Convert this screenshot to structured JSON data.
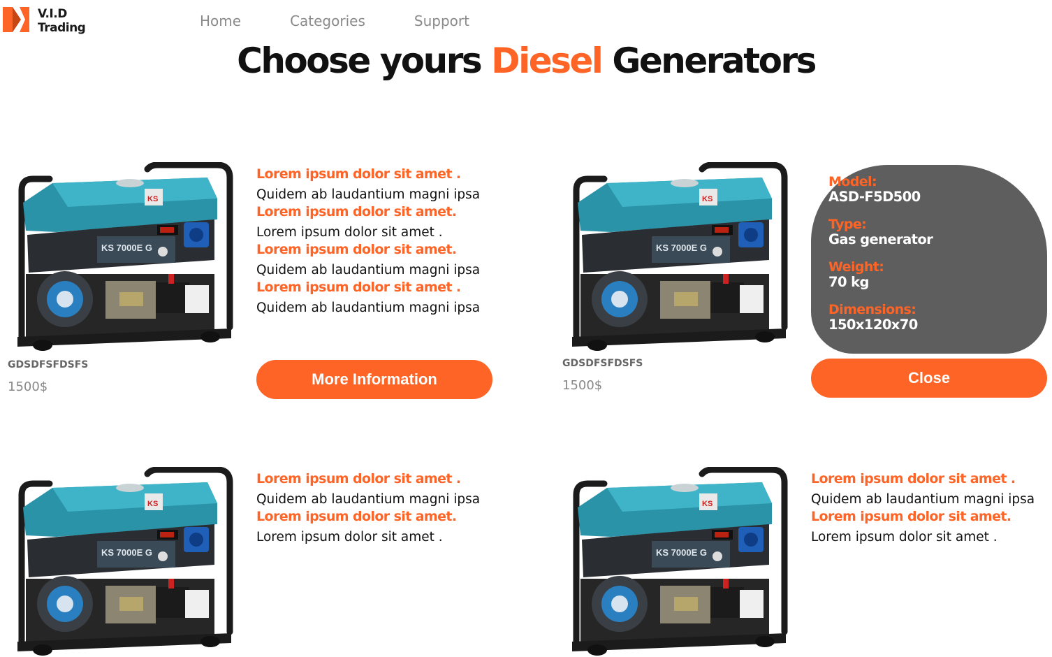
{
  "brand": {
    "line1": "V.I.D",
    "line2": "Trading",
    "color": "#fe6426"
  },
  "nav": [
    {
      "label": "Home"
    },
    {
      "label": "Categories"
    },
    {
      "label": "Support"
    }
  ],
  "headline": {
    "before": "Choose yours ",
    "accent": "Diesel",
    "after": " Generators"
  },
  "products": [
    {
      "sku": "GDSDFSFDSFS",
      "price": "1500$",
      "image_label": "KS 7000E G",
      "details": [
        {
          "label": "Lorem ipsum dolor sit amet .",
          "text": "Quidem ab laudantium magni ipsa"
        },
        {
          "label": "Lorem ipsum dolor sit amet.",
          "text": "Lorem ipsum dolor sit amet ."
        },
        {
          "label": "Lorem ipsum dolor sit amet.",
          "text": "Quidem ab laudantium magni ipsa"
        },
        {
          "label": "Lorem ipsum dolor sit amet .",
          "text": "Quidem ab laudantium magni ipsa"
        }
      ],
      "button": "More Information"
    },
    {
      "sku": "GDSDFSFDSFS",
      "price": "1500$",
      "image_label": "KS 7000E G",
      "specs": [
        {
          "key": "Model:",
          "value": "ASD-F5D500"
        },
        {
          "key": "Type:",
          "value": "Gas generator"
        },
        {
          "key": "Weight:",
          "value": "70 kg"
        },
        {
          "key": "Dimensions:",
          "value": "150x120x70"
        }
      ],
      "button": "Close"
    },
    {
      "image_label": "KS 7000E G",
      "details": [
        {
          "label": "Lorem ipsum dolor sit amet .",
          "text": "Quidem ab laudantium magni ipsa"
        },
        {
          "label": "Lorem ipsum dolor sit amet.",
          "text": "Lorem ipsum dolor sit amet ."
        }
      ]
    },
    {
      "image_label": "KS 7000E G",
      "details": [
        {
          "label": "Lorem ipsum dolor sit amet .",
          "text": "Quidem ab laudantium magni ipsa"
        },
        {
          "label": "Lorem ipsum dolor sit amet.",
          "text": "Lorem ipsum dolor sit amet ."
        }
      ]
    }
  ]
}
